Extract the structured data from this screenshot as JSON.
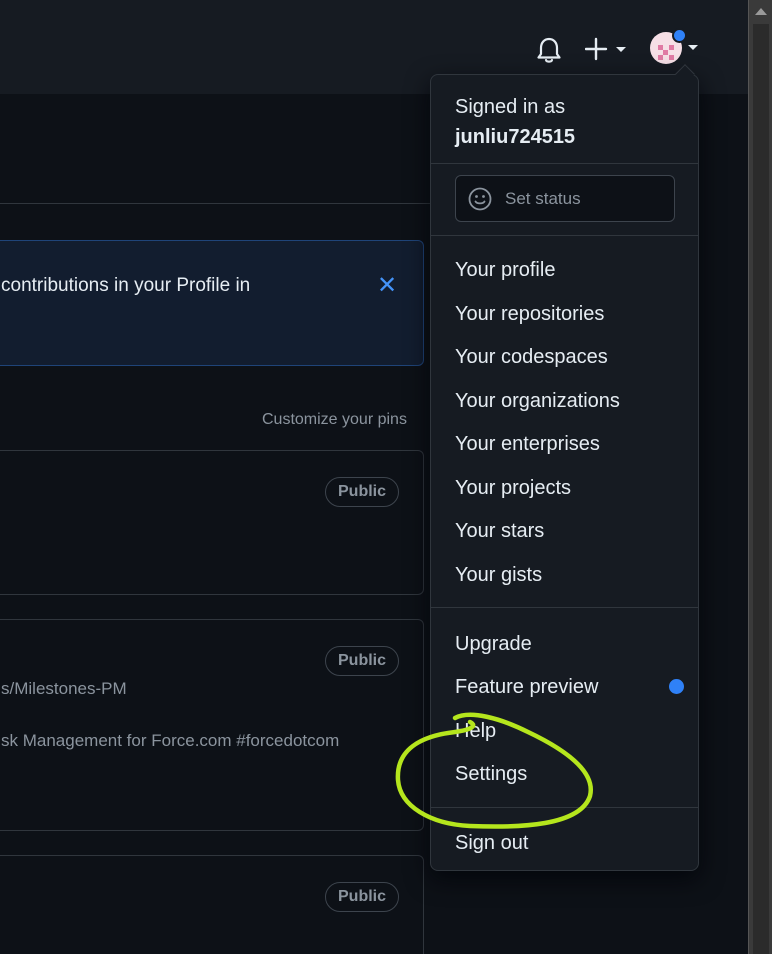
{
  "menu": {
    "signed_in_label": "Signed in as",
    "username": "junliu724515",
    "status_label": "Set status",
    "items": [
      {
        "label": "Your profile"
      },
      {
        "label": "Your repositories"
      },
      {
        "label": "Your codespaces"
      },
      {
        "label": "Your organizations"
      },
      {
        "label": "Your enterprises"
      },
      {
        "label": "Your projects"
      },
      {
        "label": "Your stars"
      },
      {
        "label": "Your gists"
      }
    ],
    "upgrade": "Upgrade",
    "feature_preview": "Feature preview",
    "help": "Help",
    "settings": "Settings",
    "sign_out": "Sign out"
  },
  "banner": {
    "text": "contributions in your Profile in"
  },
  "pins": {
    "customize_label": "Customize your pins",
    "cards": [
      {
        "badge": "Public"
      },
      {
        "badge": "Public",
        "path": "s/Milestones-PM",
        "description": "sk Management for Force.com #forcedotcom"
      },
      {
        "badge": "Public"
      }
    ]
  },
  "colors": {
    "background": "#0d1117",
    "header": "#161b22",
    "accent": "#2f81f7",
    "annotation": "#b5e61d"
  },
  "icons": {
    "notifications": "bell-icon",
    "create": "plus-icon",
    "status": "smiley-icon",
    "close": "close-icon"
  }
}
